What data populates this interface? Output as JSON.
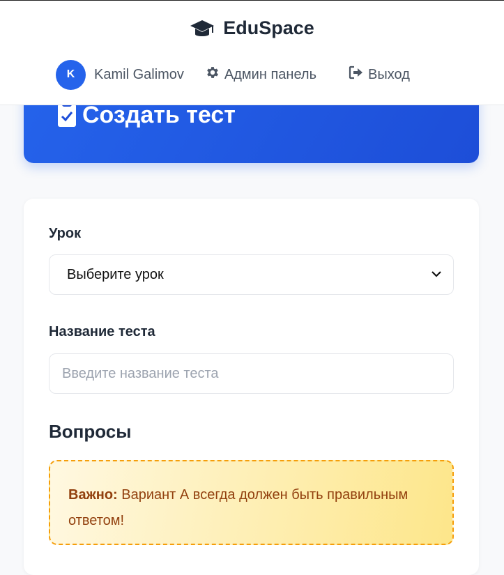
{
  "app": {
    "brand": "EduSpace"
  },
  "nav": {
    "avatar_initial": "K",
    "user_name": "Kamil Galimov",
    "admin_label": "Админ панель",
    "logout_label": "Выход"
  },
  "hero": {
    "title": "Создать тест"
  },
  "form": {
    "lesson_label": "Урок",
    "lesson_select_value": "Выберите урок",
    "test_name_label": "Название теста",
    "test_name_placeholder": "Введите название теста",
    "questions_title": "Вопросы"
  },
  "note": {
    "strong": "Важно:",
    "text": " Вариант А всегда должен быть правильным ответом!"
  },
  "colors": {
    "accent": "#2563eb",
    "warning_border": "#f59e0b",
    "warning_text": "#92400e"
  },
  "icons": {
    "brand": "graduation-cap-icon",
    "admin": "gear-icon",
    "logout": "logout-icon",
    "hero": "clipboard-check-icon",
    "select": "chevron-down-icon"
  }
}
